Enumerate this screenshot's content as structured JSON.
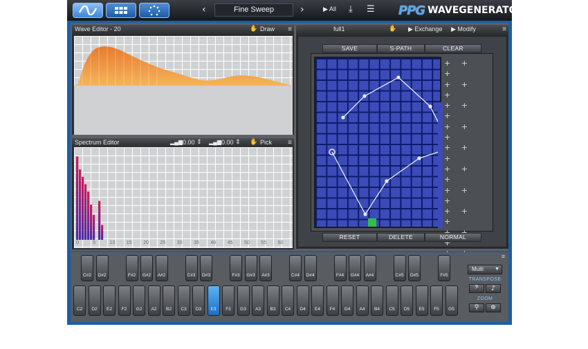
{
  "topbar": {
    "mode_icons": [
      "wave-icon",
      "grid-icon",
      "dots-icon"
    ],
    "preset_name": "Fine Sweep",
    "all_label": "▶ All",
    "logo_ppg": "PPG",
    "logo_text": "WAVEGENERATOR"
  },
  "wave_editor": {
    "title": "Wave Editor - 20",
    "draw_label": "Draw",
    "fill_color": "#f5a84b"
  },
  "spectrum_editor": {
    "title": "Spectrum Editor",
    "value_1": "0.00",
    "value_2": "0.00",
    "pick_label": "Pick",
    "ticks": [
      "0",
      "5",
      "10",
      "15",
      "20",
      "25",
      "30",
      "35",
      "40",
      "45",
      "50",
      "55",
      "60"
    ],
    "harmonics": [
      0.9,
      0.76,
      0.68,
      0.6,
      0.52,
      0.38,
      0.27,
      0.0,
      0.42,
      0.16
    ]
  },
  "wavetable": {
    "name": "full1",
    "exchange_label": "▶ Exchange",
    "modify_label": "▶ Modify",
    "buttons_top": [
      "SAVE",
      "S-PATH",
      "CLEAR"
    ],
    "buttons_bottom": [
      "RESET",
      "DELETE",
      "NORMAL"
    ],
    "grid_color": "#3c4bb8",
    "highlight_color": "#2fbf4a"
  },
  "keyboard": {
    "white_keys": [
      "C2",
      "D2",
      "E2",
      "F2",
      "G2",
      "A2",
      "B2",
      "C3",
      "D3",
      "E3",
      "F3",
      "G3",
      "A3",
      "B3",
      "C4",
      "D4",
      "E4",
      "F4",
      "G4",
      "A4",
      "B4",
      "C5",
      "D5",
      "E5",
      "F5",
      "G5"
    ],
    "active_key": "E3",
    "black_keys": [
      "C#2",
      "D#2",
      "F#2",
      "G#2",
      "A#2",
      "C#3",
      "D#3",
      "F#3",
      "G#3",
      "A#3",
      "C#4",
      "D#4",
      "F#4",
      "G#4",
      "A#4",
      "C#5",
      "D#5",
      "F#5"
    ],
    "mode_select": "Multi",
    "transpose_label": "TRANSPOSE",
    "zoom_label": "ZOOM"
  }
}
